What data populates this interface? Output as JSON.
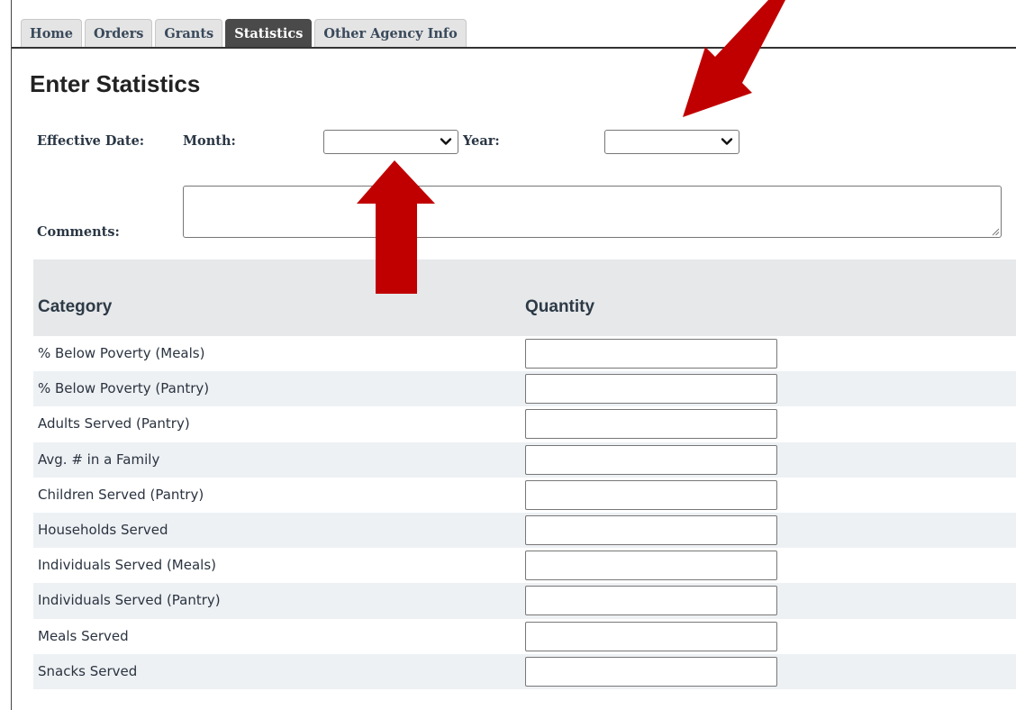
{
  "tabs": [
    "Home",
    "Orders",
    "Grants",
    "Statistics",
    "Other Agency Info"
  ],
  "active_tab": "Statistics",
  "page_title": "Enter Statistics",
  "form": {
    "effective_date_label": "Effective Date:",
    "month_label": "Month:",
    "month_value": "",
    "year_label": "Year:",
    "year_value": "",
    "comments_label": "Comments:",
    "comments_value": ""
  },
  "table": {
    "headers": [
      "Category",
      "Quantity"
    ],
    "rows": [
      {
        "category": "% Below Poverty (Meals)",
        "quantity": ""
      },
      {
        "category": "% Below Poverty (Pantry)",
        "quantity": ""
      },
      {
        "category": "Adults Served (Pantry)",
        "quantity": ""
      },
      {
        "category": "Avg. # in a Family",
        "quantity": ""
      },
      {
        "category": "Children Served (Pantry)",
        "quantity": ""
      },
      {
        "category": "Households Served",
        "quantity": ""
      },
      {
        "category": "Individuals Served (Meals)",
        "quantity": ""
      },
      {
        "category": "Individuals Served (Pantry)",
        "quantity": ""
      },
      {
        "category": "Meals Served",
        "quantity": ""
      },
      {
        "category": "Snacks Served",
        "quantity": ""
      }
    ]
  },
  "colors": {
    "active_tab_bg": "#4a4a4a",
    "tab_bg": "#e4e4e4",
    "header_bg": "#e6e8ea",
    "row_alt_bg": "#eef1f4",
    "annotation_arrow": "#c00000"
  },
  "icons": {
    "select_caret": "chevron-down-icon",
    "resize": "resize-grip-icon",
    "annotations": [
      "arrow-down-left-annotation",
      "arrow-up-annotation"
    ]
  }
}
